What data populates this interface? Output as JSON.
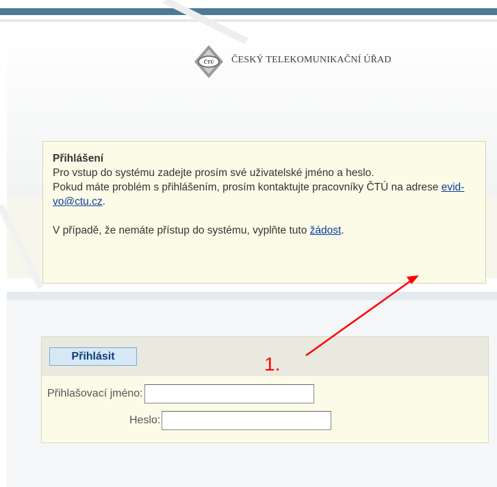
{
  "header": {
    "org_name": "ČESKÝ TELEKOMUNIKAČNÍ ÚŘAD",
    "logo_icon": "ctu-logo-icon",
    "logo_text": "ČTÚ"
  },
  "info": {
    "title": "Přihlášení",
    "line1": "Pro vstup do systému zadejte prosím své uživatelské jméno a heslo.",
    "line2_prefix": "Pokud máte problém s přihlášením, prosím kontaktujte pracovníky ČTÚ na adrese ",
    "email_link": "evid-vo@ctu.cz",
    "line2_suffix": ".",
    "line3_prefix": "V případě, že nemáte přístup do systému, vyplňte tuto ",
    "request_link": "žádost",
    "line3_suffix": "."
  },
  "login": {
    "button_label": "Přihlásit",
    "username_label": "Přihlašovací jméno:",
    "username_value": "",
    "password_label": "Heslo:",
    "password_value": ""
  },
  "annotation": {
    "label": "1.",
    "color": "#ff0000"
  },
  "colors": {
    "top_band": "#4d7a94",
    "box_background": "#fbfbe8",
    "link": "#0b3c9c",
    "button_text": "#0b3c7c"
  }
}
